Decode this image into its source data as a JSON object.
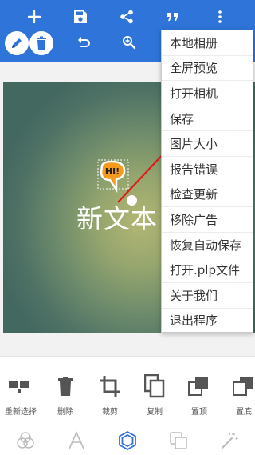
{
  "colors": {
    "toolbar": "#2f74d8",
    "arrow": "#e01818",
    "active_tab": "#2f74d8"
  },
  "toolbar": {
    "icons": [
      "add-icon",
      "save-icon",
      "share-icon",
      "quote-icon",
      "more-vert-icon",
      "pencil-icon",
      "delete-icon",
      "undo-icon",
      "zoom-in-icon"
    ]
  },
  "canvas": {
    "sticker_text": "HI!",
    "text": "新文本"
  },
  "menu": {
    "items": [
      "本地相册",
      "全屏预览",
      "打开相机",
      "保存",
      "图片大小",
      "报告错误",
      "检查更新",
      "移除广告",
      "恢复自动保存",
      "打开.plp文件",
      "关于我们",
      "退出程序"
    ]
  },
  "tools": [
    {
      "label": "重新选择",
      "icon": "reselect-icon"
    },
    {
      "label": "删除",
      "icon": "trash-icon"
    },
    {
      "label": "裁剪",
      "icon": "crop-icon"
    },
    {
      "label": "复制",
      "icon": "copy-icon"
    },
    {
      "label": "置顶",
      "icon": "bring-to-front-icon"
    },
    {
      "label": "置底",
      "icon": "send-to-back-icon"
    }
  ],
  "tabs": [
    "circles-icon",
    "text-icon",
    "shape-icon",
    "layers-icon",
    "magic-wand-icon"
  ],
  "active_tab": "shape-icon"
}
